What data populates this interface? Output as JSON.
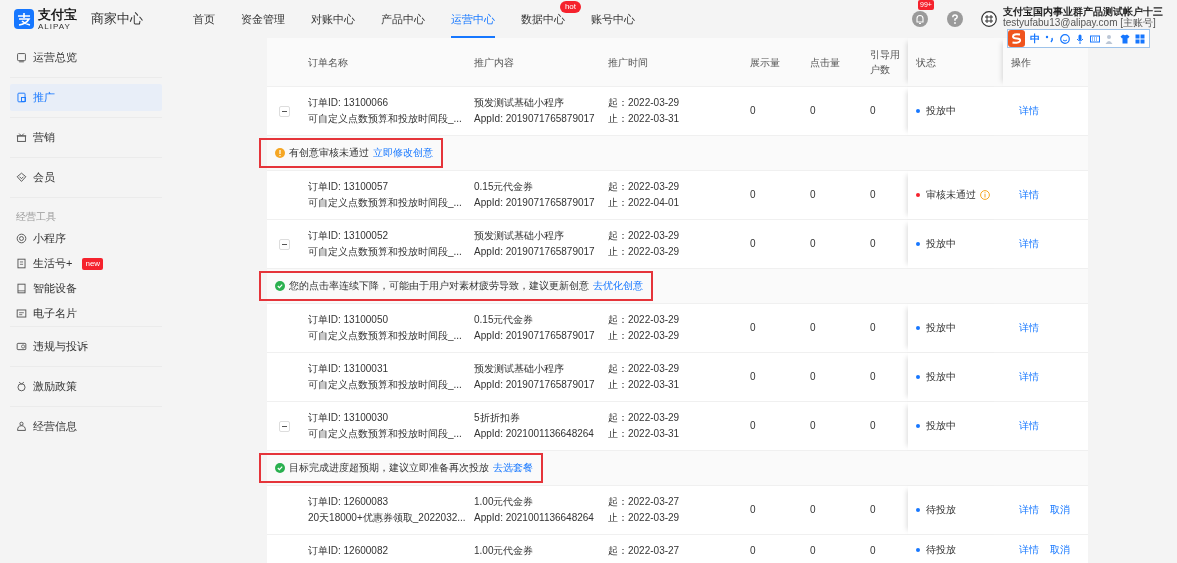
{
  "header": {
    "brand": {
      "name": "支付宝",
      "sub": "ALIPAY"
    },
    "app_title": "商家中心",
    "nav": [
      {
        "label": "首页",
        "selected": false
      },
      {
        "label": "资金管理",
        "selected": false
      },
      {
        "label": "对账中心",
        "selected": false
      },
      {
        "label": "产品中心",
        "selected": false
      },
      {
        "label": "运营中心",
        "selected": true
      },
      {
        "label": "数据中心",
        "selected": false,
        "badge": "hot"
      },
      {
        "label": "账号中心",
        "selected": false
      }
    ],
    "notifications_badge": "99+",
    "account": {
      "name": "支付宝国内事业群产品测试帐户十三",
      "email": "testyufabu13@alipay.com [主账号]"
    },
    "ime_toolbar": {
      "mode": "中"
    }
  },
  "sidebar": {
    "groups": [
      {
        "items": [
          {
            "label": "运营总览",
            "selected": false
          }
        ]
      },
      {
        "items": [
          {
            "label": "推广",
            "selected": true
          }
        ]
      },
      {
        "items": [
          {
            "label": "营销",
            "selected": false
          }
        ]
      },
      {
        "items": [
          {
            "label": "会员",
            "selected": false
          }
        ]
      },
      {
        "title": "经营工具",
        "items": [
          {
            "label": "小程序",
            "selected": false
          },
          {
            "label": "生活号+",
            "selected": false,
            "badge": "new"
          },
          {
            "label": "智能设备",
            "selected": false
          },
          {
            "label": "电子名片",
            "selected": false
          }
        ]
      },
      {
        "items": [
          {
            "label": "违规与投诉",
            "selected": false
          }
        ]
      },
      {
        "items": [
          {
            "label": "激励政策",
            "selected": false
          }
        ]
      },
      {
        "items": [
          {
            "label": "经营信息",
            "selected": false
          }
        ]
      }
    ]
  },
  "table": {
    "columns": [
      "订单名称",
      "推广内容",
      "推广时间",
      "展示量",
      "点击量",
      "引导用户数",
      "状态",
      "操作"
    ],
    "rows": [
      {
        "kind": "order",
        "expandable": true,
        "id": "订单ID: 13100066",
        "desc": "可自定义点数预算和投放时间段_...",
        "content": "预发测试基础小程序",
        "appid": "AppId: 2019071765879017",
        "start": "起：2022-03-29",
        "end": "止：2022-03-31",
        "impressions": "0",
        "clicks": "0",
        "users": "0",
        "status": {
          "text": "投放中",
          "color": "#1677ff",
          "info": false
        },
        "actions": [
          "详情"
        ],
        "alert": {
          "warning": true,
          "highlighted": true,
          "text": "有创意审核未通过",
          "link": "立即修改创意"
        }
      },
      {
        "kind": "order",
        "expandable": false,
        "id": "订单ID: 13100057",
        "desc": "可自定义点数预算和投放时间段_...",
        "content": "0.15元代金券",
        "appid": "AppId: 2019071765879017",
        "start": "起：2022-03-29",
        "end": "止：2022-04-01",
        "impressions": "0",
        "clicks": "0",
        "users": "0",
        "status": {
          "text": "审核未通过",
          "color": "#f5222d",
          "info": true
        },
        "actions": [
          "详情"
        ]
      },
      {
        "kind": "order",
        "expandable": true,
        "id": "订单ID: 13100052",
        "desc": "可自定义点数预算和投放时间段_...",
        "content": "预发测试基础小程序",
        "appid": "AppId: 2019071765879017",
        "start": "起：2022-03-29",
        "end": "止：2022-03-29",
        "impressions": "0",
        "clicks": "0",
        "users": "0",
        "status": {
          "text": "投放中",
          "color": "#1677ff",
          "info": false
        },
        "actions": [
          "详情"
        ],
        "alert": {
          "warning": false,
          "highlighted": true,
          "text": "您的点击率连续下降，可能由于用户对素材疲劳导致，建议更新创意",
          "link": "去优化创意"
        }
      },
      {
        "kind": "order",
        "expandable": false,
        "id": "订单ID: 13100050",
        "desc": "可自定义点数预算和投放时间段_...",
        "content": "0.15元代金券",
        "appid": "AppId: 2019071765879017",
        "start": "起：2022-03-29",
        "end": "止：2022-03-29",
        "impressions": "0",
        "clicks": "0",
        "users": "0",
        "status": {
          "text": "投放中",
          "color": "#1677ff",
          "info": false
        },
        "actions": [
          "详情"
        ]
      },
      {
        "kind": "order",
        "expandable": false,
        "id": "订单ID: 13100031",
        "desc": "可自定义点数预算和投放时间段_...",
        "content": "预发测试基础小程序",
        "appid": "AppId: 2019071765879017",
        "start": "起：2022-03-29",
        "end": "止：2022-03-31",
        "impressions": "0",
        "clicks": "0",
        "users": "0",
        "status": {
          "text": "投放中",
          "color": "#1677ff",
          "info": false
        },
        "actions": [
          "详情"
        ]
      },
      {
        "kind": "order",
        "expandable": true,
        "id": "订单ID: 13100030",
        "desc": "可自定义点数预算和投放时间段_...",
        "content": "5折折扣券",
        "appid": "AppId: 2021001136648264",
        "start": "起：2022-03-29",
        "end": "止：2022-03-31",
        "impressions": "0",
        "clicks": "0",
        "users": "0",
        "status": {
          "text": "投放中",
          "color": "#1677ff",
          "info": false
        },
        "actions": [
          "详情"
        ],
        "alert": {
          "warning": false,
          "highlighted": true,
          "text": "目标完成进度超预期，建议立即准备再次投放",
          "link": "去选套餐"
        }
      },
      {
        "kind": "order",
        "expandable": false,
        "id": "订单ID: 12600083",
        "desc": "20天18000+优惠券领取_2022032...",
        "content": "1.00元代金券",
        "appid": "AppId: 2021001136648264",
        "start": "起：2022-03-27",
        "end": "止：2022-03-29",
        "impressions": "0",
        "clicks": "0",
        "users": "0",
        "status": {
          "text": "待投放",
          "color": "#1677ff",
          "info": false
        },
        "actions": [
          "详情",
          "取消"
        ]
      },
      {
        "kind": "order",
        "expandable": false,
        "id": "订单ID: 12600082",
        "content": "1.00元代金券",
        "start": "起：2022-03-27",
        "impressions": "0",
        "clicks": "0",
        "users": "0",
        "status": {
          "text": "待投放",
          "color": "#1677ff",
          "info": false
        },
        "actions": [
          "详情",
          "取消"
        ]
      }
    ]
  }
}
